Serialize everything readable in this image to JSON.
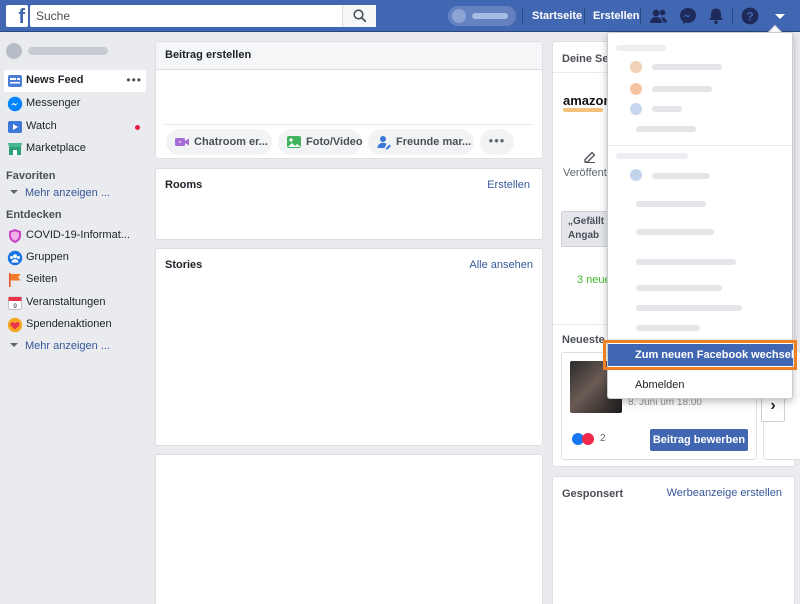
{
  "topbar": {
    "logo": "f",
    "search_placeholder": "Suche",
    "nav": [
      "Startseite",
      "Erstellen"
    ],
    "icons": [
      "friend-requests-icon",
      "messenger-icon",
      "notifications-icon",
      "help-icon",
      "account-menu-icon"
    ]
  },
  "sidebar": {
    "items": [
      {
        "label": "News Feed",
        "icon": "news-feed-icon"
      },
      {
        "label": "Messenger",
        "icon": "messenger-icon"
      },
      {
        "label": "Watch",
        "icon": "watch-icon"
      },
      {
        "label": "Marketplace",
        "icon": "marketplace-icon"
      }
    ],
    "favorites_heading": "Favoriten",
    "more_label": "Mehr anzeigen ...",
    "explore_heading": "Entdecken",
    "explore": [
      {
        "label": "COVID-19-Informat...",
        "icon": "covid-shield-icon"
      },
      {
        "label": "Gruppen",
        "icon": "groups-icon"
      },
      {
        "label": "Seiten",
        "icon": "pages-flag-icon"
      },
      {
        "label": "Veranstaltungen",
        "icon": "events-calendar-icon"
      },
      {
        "label": "Spendenaktionen",
        "icon": "fundraiser-icon"
      }
    ],
    "explore_more_label": "Mehr anzeigen ..."
  },
  "composer": {
    "title": "Beitrag erstellen",
    "actions": [
      {
        "label": "Chatroom er...",
        "icon": "video-chat-icon"
      },
      {
        "label": "Foto/Video",
        "icon": "photo-video-icon"
      },
      {
        "label": "Freunde mar...",
        "icon": "tag-friends-icon"
      }
    ],
    "more": "•••"
  },
  "rooms": {
    "title": "Rooms",
    "link": "Erstellen"
  },
  "stories": {
    "title": "Stories",
    "link": "Alle ansehen"
  },
  "pages_panel": {
    "title": "Deine Sei",
    "brand": "amazon",
    "publish_label": "Veröffentlichen",
    "liked_text_1": "„Gefällt n",
    "liked_text_2": "Angab",
    "new_count": "3 neue",
    "recent_title": "Neueste",
    "post_date": "8. Juni um 18:00",
    "reaction_count": "2",
    "boost_label": "Beitrag bewerben",
    "arrow": "›"
  },
  "sponsored": {
    "title": "Gesponsert",
    "link": "Werbeanzeige erstellen"
  },
  "dropdown": {
    "switch_label": "Zum neuen Facebook wechseln",
    "logout_label": "Abmelden"
  },
  "colors": {
    "brand": "#4267b2",
    "highlight": "#ee7f22",
    "link": "#365899"
  }
}
